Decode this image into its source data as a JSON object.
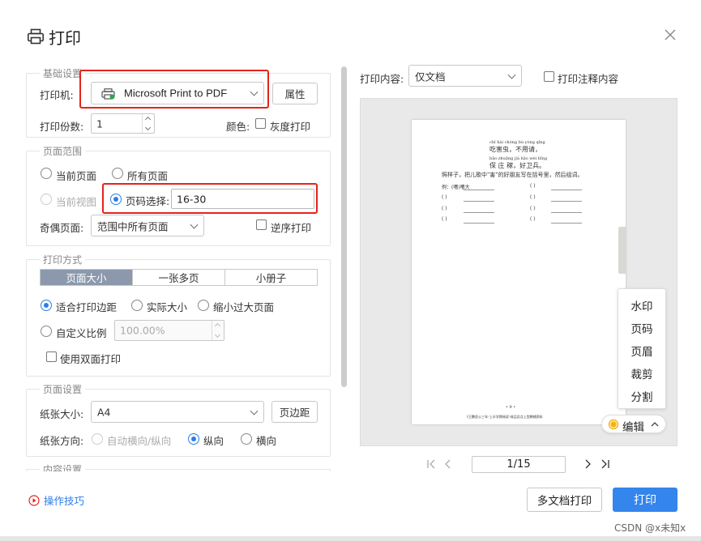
{
  "dialog": {
    "title": "打印",
    "icons": {
      "title": "printer-icon",
      "close": "close-icon"
    }
  },
  "basic_settings": {
    "title": "基础设置",
    "printer_label": "打印机:",
    "printer_value": "Microsoft Print to PDF",
    "properties_button": "属性",
    "copies_label": "打印份数:",
    "copies_value": "1",
    "color_label": "颜色:",
    "grayscale_label": "灰度打印",
    "grayscale_checked": false
  },
  "page_range": {
    "title": "页面范围",
    "current_page": "当前页面",
    "all_pages": "所有页面",
    "current_view": "当前视图",
    "page_select_label": "页码选择:",
    "page_select_value": "16-30",
    "selected_option": "page_select",
    "odd_even_label": "奇偶页面:",
    "odd_even_value": "范围中所有页面",
    "reverse_label": "逆序打印",
    "reverse_checked": false
  },
  "print_mode": {
    "title": "打印方式",
    "tabs": [
      "页面大小",
      "一张多页",
      "小册子"
    ],
    "active_tab": 0,
    "fit_margins": "适合打印边距",
    "actual_size": "实际大小",
    "shrink_large": "缩小过大页面",
    "custom_scale": "自定义比例",
    "custom_scale_value": "100.00%",
    "duplex_label": "使用双面打印",
    "duplex_checked": false,
    "selected_option": "fit_margins"
  },
  "page_setup": {
    "title": "页面设置",
    "paper_size_label": "纸张大小:",
    "paper_size_value": "A4",
    "margins_button": "页边距",
    "orientation_label": "纸张方向:",
    "auto_orientation": "自动横向/纵向",
    "portrait": "纵向",
    "landscape": "横向",
    "selected_orientation": "portrait"
  },
  "content_settings": {
    "title": "内容设置"
  },
  "preview": {
    "content_label": "打印内容:",
    "content_value": "仅文档",
    "annotations_label": "打印注释内容",
    "annotations_checked": false,
    "page": {
      "pinyin_line_1": "chī hài chóng    bù yòng qǐng",
      "chinese_line_1": "吃害虫，不用请，",
      "pinyin_line_2": "bǎo zhuāng jià   hǎo wèi bīng",
      "chinese_line_2": "保 庄 稼，好卫兵。",
      "instruction": "照样子，把儿歌中\"害\"的好朋友写在括号里，然后组词。",
      "example": "例：(嗜)嗜大",
      "paren_blank": "(      )",
      "page_number": "• 9 •",
      "footer": "《王鹏亚公三年\"上半学期阅读\"成品及点上型教辅资料"
    },
    "edit_menu": [
      "水印",
      "页码",
      "页眉",
      "裁剪",
      "分割"
    ],
    "edit_button": "编辑",
    "pager_value": "1/15"
  },
  "footer": {
    "tips_label": "操作技巧",
    "multi_print_button": "多文档打印",
    "print_button": "打印",
    "watermark": "CSDN @x未知x"
  },
  "colors": {
    "accent": "#3485ec",
    "highlight_box": "#e5231a",
    "tab_active": "#8c99ad"
  }
}
